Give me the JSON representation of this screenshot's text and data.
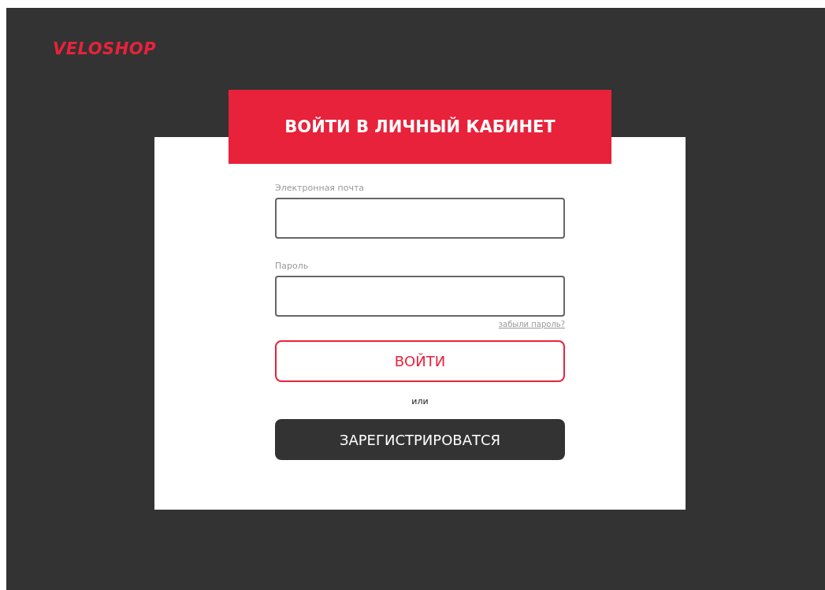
{
  "logo": "VELOSHOP",
  "form": {
    "title": "ВОЙТИ В ЛИЧНЫЙ КАБИНЕТ",
    "fields": [
      {
        "label": "Электронная почта"
      },
      {
        "label": "Пароль"
      }
    ],
    "forgot_link": "забыли пароль?",
    "login_button": "ВОЙТИ",
    "separator": "или",
    "register_button": "ЗАРЕГИСТРИРОВАТСЯ"
  }
}
